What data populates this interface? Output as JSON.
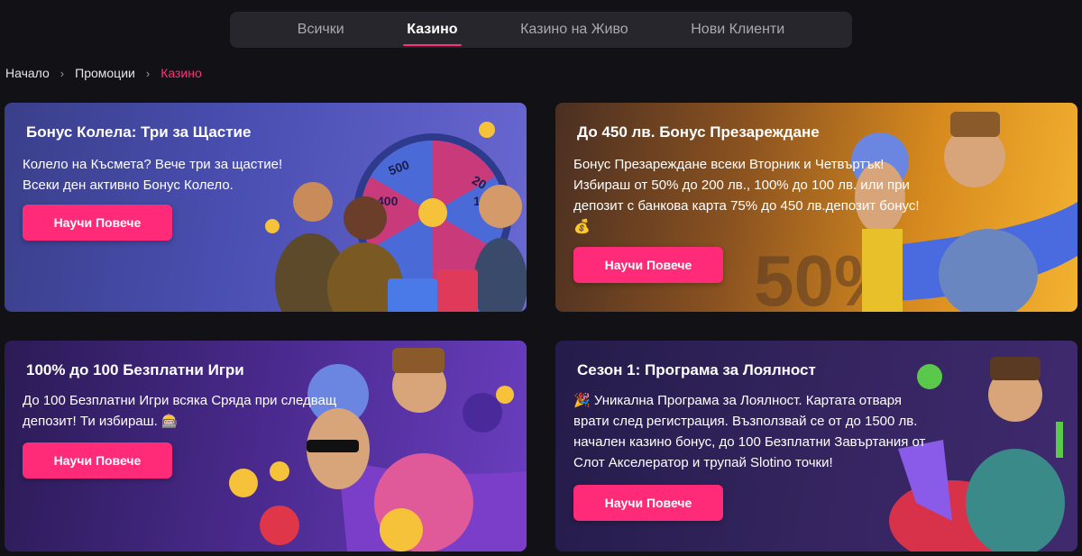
{
  "tabs": [
    {
      "label": "Всички"
    },
    {
      "label": "Казино"
    },
    {
      "label": "Казино на Живо"
    },
    {
      "label": "Нови Клиенти"
    }
  ],
  "breadcrumb": {
    "home": "Начало",
    "promotions": "Промоции",
    "current": "Казино"
  },
  "cards": [
    {
      "title": "Бонус Колела: Три за Щастие",
      "desc_lines": [
        "Колело на Късмета? Вече три за щастие!",
        "Всеки ден активно Бонус Колело."
      ],
      "button": "Научи Повече"
    },
    {
      "title": "До 450 лв. Бонус Презареждане",
      "desc_lines": [
        "Бонус Презареждане всеки Вторник и Четвъртък!",
        "Избираш от 50% до 200 лв., 100% до 100 лв. или при",
        "депозит с банкова карта 75% до 450 лв.депозит бонус!",
        "💰"
      ],
      "button": "Научи Повече"
    },
    {
      "title": "100% до 100 Безплатни Игри",
      "desc_lines": [
        "До 100 Безплатни Игри всяка Сряда при следващ",
        "депозит! Ти избираш. 🎰"
      ],
      "button": "Научи Повече"
    },
    {
      "title": "Сезон 1: Програма за Лоялност",
      "desc_lines": [
        "🎉 Уникална Програма за Лоялност. Картата отваря",
        "врати след регистрация. Възползвай се от до 1500 лв.",
        "начален казино бонус, до 100 Безплатни Завъртания от",
        "Слот Акселератор и трупай Slotino точки!"
      ],
      "button": "Научи Повече"
    }
  ],
  "art": {
    "wheel_labels": [
      "500",
      "400",
      "20",
      "10"
    ],
    "percent_text": "50%"
  },
  "colors": {
    "accent": "#ff2a78",
    "tab_bar": "#26262c",
    "page_bg": "#121216"
  }
}
